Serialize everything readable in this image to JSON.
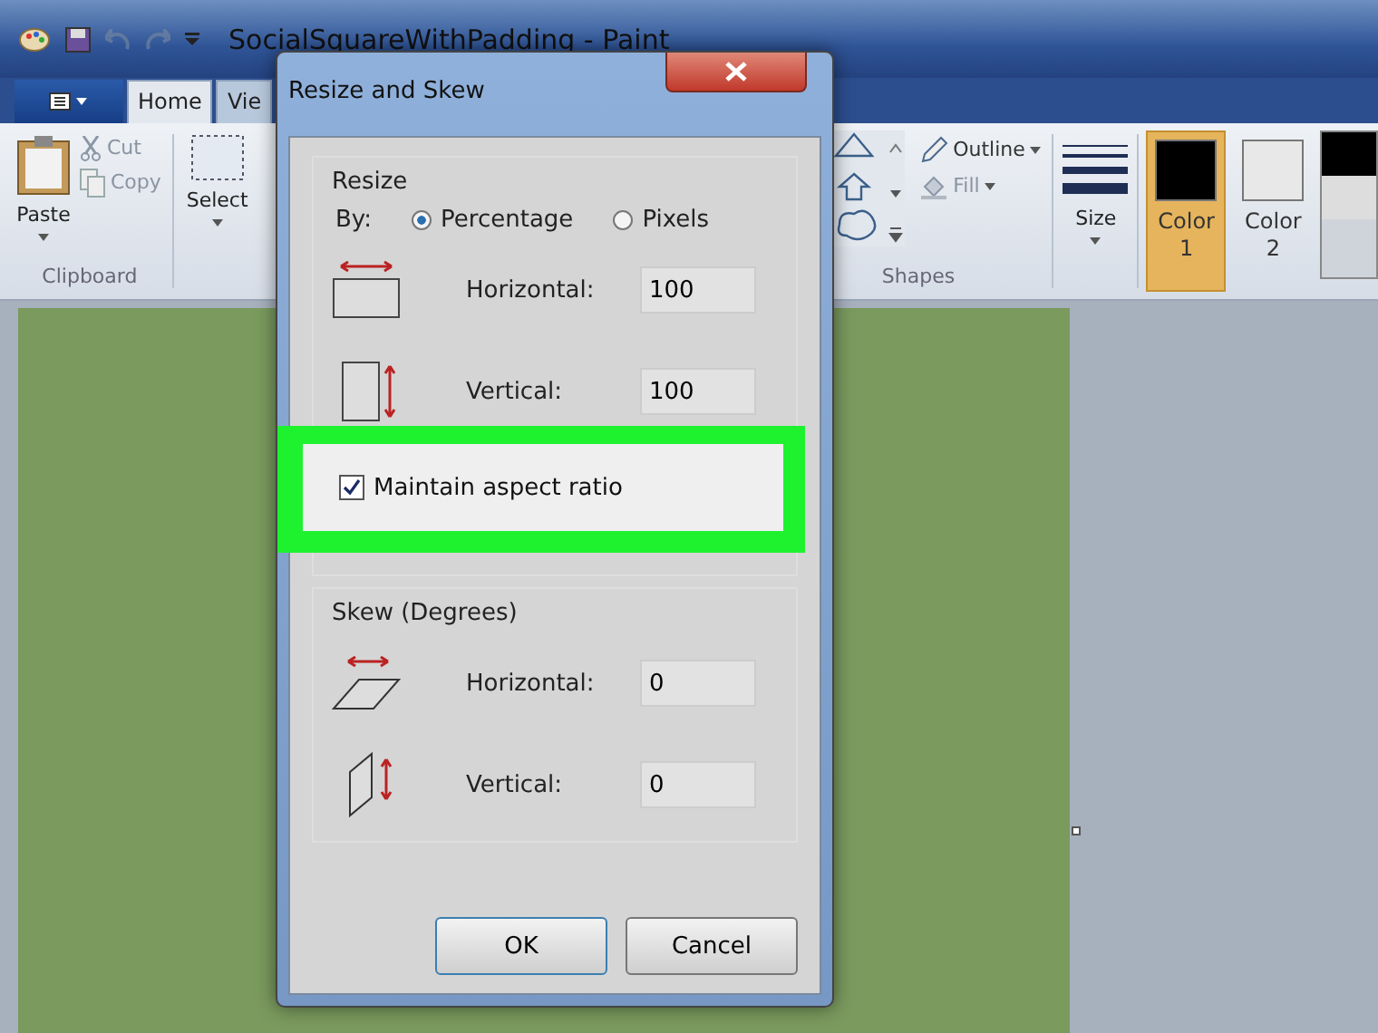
{
  "window": {
    "title": "SocialSquareWithPadding - Paint"
  },
  "tabs": [
    {
      "label": "Home",
      "selected": true
    },
    {
      "label": "Vie",
      "selected": false
    }
  ],
  "ribbon": {
    "clipboard": {
      "paste": "Paste",
      "cut": "Cut",
      "copy": "Copy",
      "group": "Clipboard"
    },
    "select": "Select",
    "shapes_group": "Shapes",
    "outline": "Outline",
    "fill": "Fill",
    "size": "Size",
    "colors": [
      {
        "label": "Color",
        "number": "1",
        "color": "#000000",
        "selected": true
      },
      {
        "label": "Color",
        "number": "2",
        "color": "#e8e8e8",
        "selected": false
      }
    ]
  },
  "dialog": {
    "title": "Resize and Skew",
    "resize_heading": "Resize",
    "by_label": "By:",
    "by_options": [
      {
        "label": "Percentage",
        "selected": true
      },
      {
        "label": "Pixels",
        "selected": false
      }
    ],
    "resize_fields": [
      {
        "label": "Horizontal:",
        "value": "100"
      },
      {
        "label": "Vertical:",
        "value": "100"
      }
    ],
    "maintain_aspect": {
      "label": "Maintain aspect ratio",
      "checked": true
    },
    "skew_heading": "Skew (Degrees)",
    "skew_fields": [
      {
        "label": "Horizontal:",
        "value": "0"
      },
      {
        "label": "Vertical:",
        "value": "0"
      }
    ],
    "buttons": [
      "OK",
      "Cancel"
    ]
  }
}
